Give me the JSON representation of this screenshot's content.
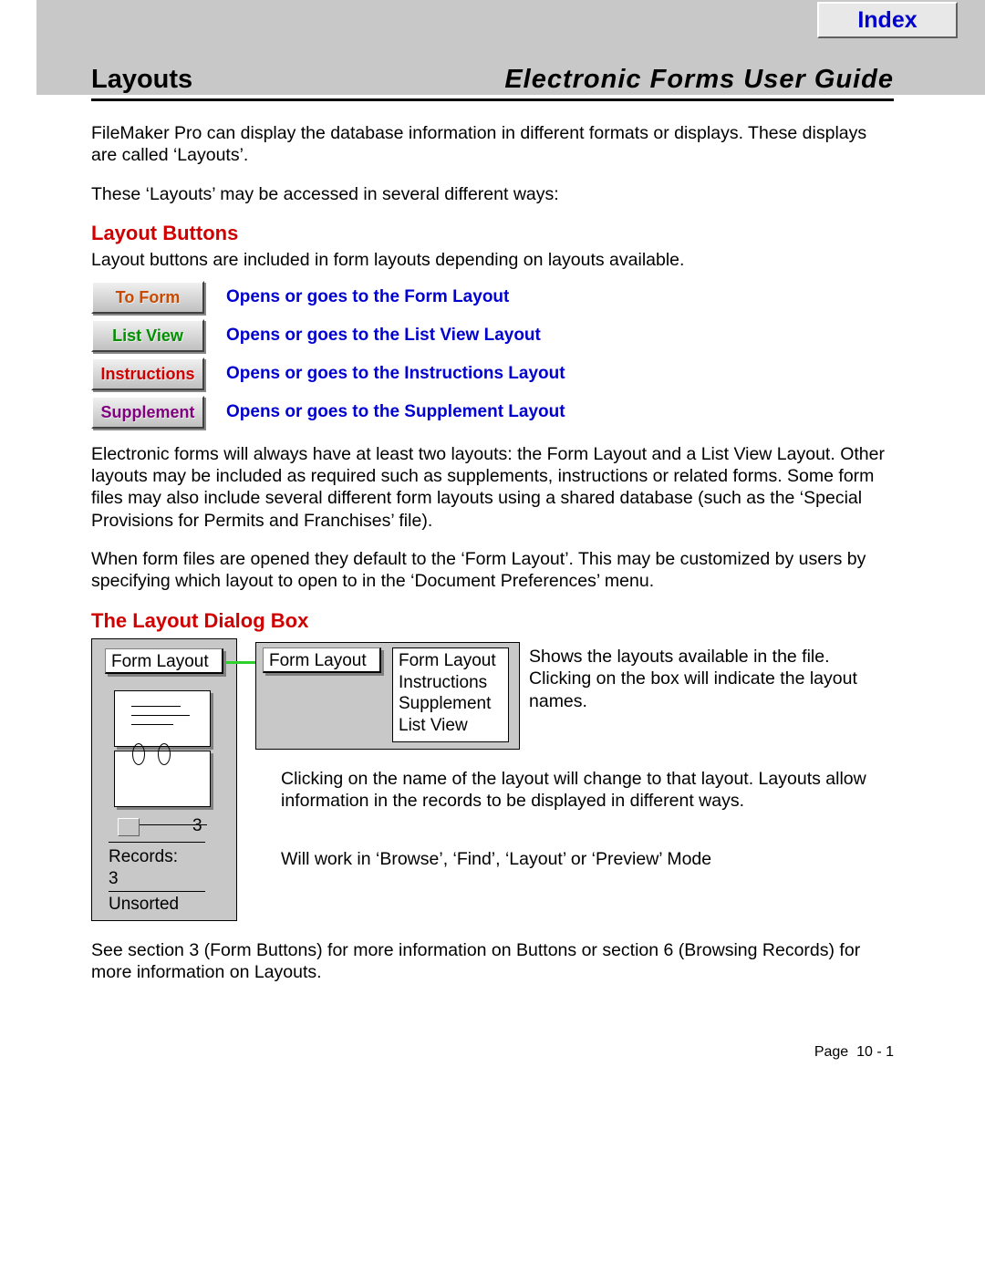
{
  "header": {
    "index_label": "Index",
    "section": "Layouts",
    "doc_title": "Electronic Forms User Guide"
  },
  "intro": {
    "p1": "FileMaker Pro can display the database information in different formats or displays. These displays are called ‘Layouts’.",
    "p2": "These ‘Layouts’ may be accessed in several different ways:"
  },
  "sect1": {
    "heading": "Layout Buttons",
    "intro": "Layout buttons are included in form layouts depending on layouts available.",
    "buttons": [
      {
        "label": "To Form",
        "desc": "Opens or goes to the Form Layout"
      },
      {
        "label": "List View",
        "desc": "Opens or goes to the List View Layout"
      },
      {
        "label": "Instructions",
        "desc": "Opens or goes to the Instructions Layout"
      },
      {
        "label": "Supplement",
        "desc": "Opens or goes to the Supplement Layout"
      }
    ],
    "p_after1": "Electronic forms will always have at least two layouts: the Form Layout and a List View Layout. Other layouts may be included as required such as supplements, instructions or related forms. Some form files may also include several different form layouts using a shared database (such as the ‘Special Provisions for Permits and Franchises’ file).",
    "p_after2": "When form files are opened they default to the ‘Form Layout’. This may be customized by users by specifying which layout to open to in the ‘Document Preferences’ menu."
  },
  "sect2": {
    "heading": "The Layout Dialog Box",
    "sidebar": {
      "selected": "Form Layout",
      "page_num": "3",
      "records_label": "Records:",
      "records_value": "3",
      "sort_state": "Unsorted"
    },
    "popup_selected": "Form Layout",
    "layout_names": [
      "Form Layout",
      "Instructions",
      "Supplement",
      "List View"
    ],
    "desc_right": "Shows the layouts available in the file. Clicking on the box will indicate the layout names.",
    "desc_mid": "Clicking on the name of the layout will change to that layout. Layouts allow information in the records to be displayed in different ways.",
    "desc_modes": "Will work in ‘Browse’, ‘Find’, ‘Layout’ or ‘Preview’ Mode",
    "p_after": "See section 3 (Form Buttons) for more information on Buttons or section 6 (Browsing Records) for more information on Layouts."
  },
  "footer": {
    "page": "Page  10 - 1"
  }
}
